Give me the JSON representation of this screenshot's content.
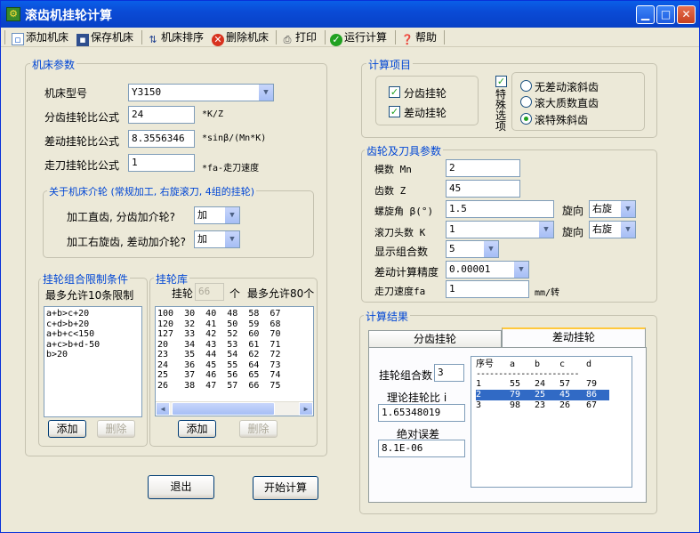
{
  "window": {
    "title": "滚齿机挂轮计算"
  },
  "toolbar": {
    "add_machine": "添加机床",
    "save_machine": "保存机床",
    "sort_machine": "机床排序",
    "delete_machine": "删除机床",
    "print": "打印",
    "run_calc": "运行计算",
    "help": "帮助"
  },
  "machine": {
    "legend": "机床参数",
    "model_label": "机床型号",
    "model_value": "Y3150",
    "index_label": "分齿挂轮比公式",
    "index_value": "24",
    "index_unit": "*K/Z",
    "diff_label": "差动挂轮比公式",
    "diff_value": "8.3556346",
    "diff_unit": "*sinβ/(Mn*K)",
    "feed_label": "走刀挂轮比公式",
    "feed_value": "1",
    "feed_unit": "*fa-走刀速度",
    "idler": {
      "legend": "关于机床介轮 (常规加工, 右旋滚刀, 4组的挂轮)",
      "straight_label": "加工直齿, 分齿加介轮?",
      "straight_value": "加",
      "helical_label": "加工右旋齿, 差动加介轮?",
      "helical_value": "加"
    }
  },
  "constraints": {
    "legend": "挂轮组合限制条件",
    "limit_text": "最多允许10条限制",
    "items": [
      "a+b>c+20",
      "c+d>b+20",
      "a+b+c<150",
      "a+c>b+d-50",
      "b>20"
    ],
    "add_button": "添加",
    "delete_button": "删除"
  },
  "gear_library": {
    "legend": "挂轮库",
    "gear_label": "挂轮",
    "count": "66",
    "unit": "个",
    "limit_text": "最多允许80个",
    "rows": [
      "100  30  40  48  58  67",
      "120  32  41  50  59  68",
      "127  33  42  52  60  70",
      "20   34  43  53  61  71",
      "23   35  44  54  62  72",
      "24   36  45  55  64  73",
      "25   37  46  56  65  74",
      "26   38  47  57  66  75"
    ],
    "add_button": "添加",
    "delete_button": "删除"
  },
  "buttons": {
    "exit": "退出",
    "start": "开始计算"
  },
  "calc_items": {
    "legend": "计算项目",
    "index_gear": "分齿挂轮",
    "diff_gear": "差动挂轮",
    "special": "特殊选项",
    "options": [
      "无差动滚斜齿",
      "滚大质数直齿",
      "滚特殊斜齿"
    ],
    "selected_option": "滚特殊斜齿"
  },
  "params": {
    "legend": "齿轮及刀具参数",
    "module_label": "模数 Mn",
    "module_value": "2",
    "teeth_label": "齿数 Z",
    "teeth_value": "45",
    "helix_label": "螺旋角 β(°)",
    "helix_value": "1.5",
    "helix_dir_label": "旋向",
    "helix_dir_value": "右旋",
    "hob_label": "滚刀头数 K",
    "hob_value": "1",
    "hob_dir_label": "旋向",
    "hob_dir_value": "右旋",
    "display_label": "显示组合数",
    "display_value": "5",
    "precision_label": "差动计算精度",
    "precision_value": "0.00001",
    "feed_label": "走刀速度fa",
    "feed_value": "1",
    "feed_unit": "mm/转"
  },
  "results": {
    "legend": "计算结果",
    "tabs": [
      "分齿挂轮",
      "差动挂轮"
    ],
    "active_tab": "差动挂轮",
    "combo_label": "挂轮组合数",
    "combo_value": "3",
    "ratio_label": "理论挂轮比 i",
    "ratio_value": "1.65348019",
    "error_label": "绝对误差",
    "error_value": "8.1E-06",
    "columns": [
      "序号",
      "a",
      "b",
      "c",
      "d"
    ],
    "rows": [
      [
        "1",
        "55",
        "24",
        "57",
        "79"
      ],
      [
        "2",
        "79",
        "25",
        "45",
        "86"
      ],
      [
        "3",
        "98",
        "23",
        "26",
        "67"
      ]
    ],
    "selected_row": "2"
  },
  "colors": {
    "title_bar": "#0A4BD6",
    "legend_text": "#0046D5",
    "selection": "#316AC5"
  }
}
